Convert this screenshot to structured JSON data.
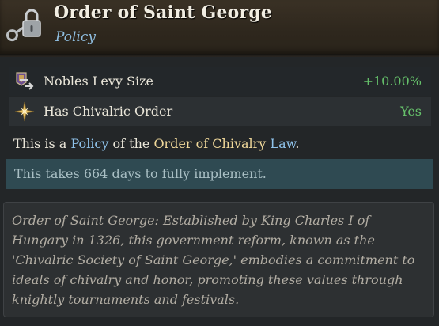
{
  "header": {
    "title": "Order of Saint George",
    "subtitle": "Policy",
    "icon": "lock-key-icon"
  },
  "modifiers": [
    {
      "label": "Nobles Levy Size",
      "value": "+10.00%",
      "icon": "levy-banner-icon",
      "value_color": "#66c26b"
    },
    {
      "label": "Has Chivalric Order",
      "value": "Yes",
      "icon": "star-burst-icon",
      "value_color": "#66c26b"
    }
  ],
  "policy_line": {
    "prefix": "This is a ",
    "policy_word": "Policy",
    "middle": " of the ",
    "law_name": "Order of Chivalry",
    "space": " ",
    "law_word": "Law",
    "suffix": "."
  },
  "implementation": {
    "text": "This takes 664 days to fully implement."
  },
  "description": {
    "lines": [
      "Order of Saint George: Established by King Charles I of",
      "Hungary in 1326, this government reform, known as the",
      "'Chivalric Society of Saint George,' embodies a commitment to",
      "ideals of chivalry and honor, promoting these values through",
      "knightly tournaments and festivals."
    ]
  },
  "colors": {
    "positive": "#66c26b",
    "link_blue": "#8fc2ea",
    "law_gold": "#f0d89a",
    "header_bg": "#2e271d"
  }
}
